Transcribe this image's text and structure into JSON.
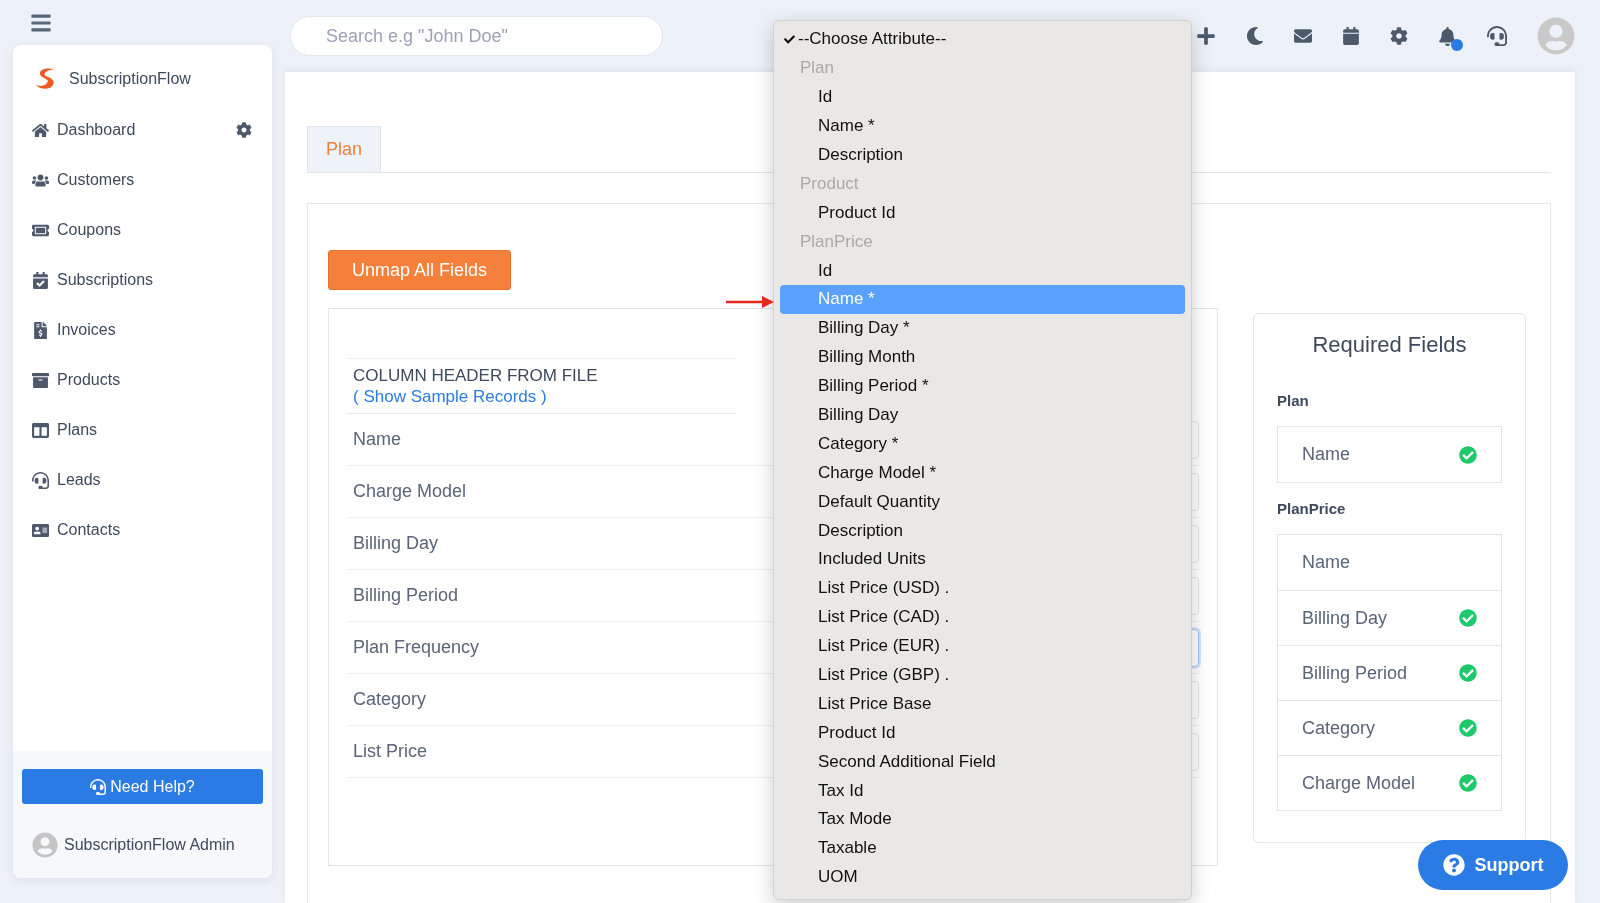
{
  "sidebar": {
    "brand": "SubscriptionFlow",
    "items": [
      {
        "label": "Dashboard"
      },
      {
        "label": "Customers"
      },
      {
        "label": "Coupons"
      },
      {
        "label": "Subscriptions"
      },
      {
        "label": "Invoices"
      },
      {
        "label": "Products"
      },
      {
        "label": "Plans"
      },
      {
        "label": "Leads"
      },
      {
        "label": "Contacts"
      }
    ],
    "help_button": "Need Help?",
    "user": "SubscriptionFlow Admin"
  },
  "topbar": {
    "search": {
      "placeholder": "Search e.g \"John Doe\""
    },
    "notifications_unread": true
  },
  "tabs": [
    {
      "label": "Plan",
      "selected": true
    }
  ],
  "unmap_button": "Unmap All Fields",
  "mapping": {
    "header": "COLUMN HEADER FROM FILE",
    "header_link": "( Show Sample Records )",
    "rows": [
      {
        "label": "Name",
        "focused": false
      },
      {
        "label": "Charge Model",
        "focused": false
      },
      {
        "label": "Billing Day",
        "focused": false
      },
      {
        "label": "Billing Period",
        "focused": false
      },
      {
        "label": "Plan Frequency",
        "focused": true
      },
      {
        "label": "Category",
        "focused": false
      },
      {
        "label": "List Price",
        "focused": false
      }
    ]
  },
  "dropdown": {
    "current": {
      "label": "--Choose Attribute--",
      "checked": true
    },
    "groups": [
      {
        "label": "Plan",
        "options": [
          {
            "label": "Id",
            "selected": false
          },
          {
            "label": "Name *",
            "selected": false
          },
          {
            "label": "Description",
            "selected": false
          }
        ]
      },
      {
        "label": "Product",
        "options": [
          {
            "label": "Product Id",
            "selected": false
          }
        ]
      },
      {
        "label": "PlanPrice",
        "options": [
          {
            "label": "Id",
            "selected": false
          },
          {
            "label": "Name *",
            "selected": true
          },
          {
            "label": "Billing Day *",
            "selected": false
          },
          {
            "label": "Billing Month",
            "selected": false
          },
          {
            "label": "Billing Period *",
            "selected": false
          },
          {
            "label": "Billing Day",
            "selected": false
          },
          {
            "label": "Category *",
            "selected": false
          },
          {
            "label": "Charge Model *",
            "selected": false
          },
          {
            "label": "Default Quantity",
            "selected": false
          },
          {
            "label": "Description",
            "selected": false
          },
          {
            "label": "Included Units",
            "selected": false
          },
          {
            "label": "List Price (USD) .",
            "selected": false
          },
          {
            "label": "List Price (CAD) .",
            "selected": false
          },
          {
            "label": "List Price (EUR) .",
            "selected": false
          },
          {
            "label": "List Price (GBP) .",
            "selected": false
          },
          {
            "label": "List Price Base",
            "selected": false
          },
          {
            "label": "Product Id",
            "selected": false
          },
          {
            "label": "Second Additional Field",
            "selected": false
          },
          {
            "label": "Tax Id",
            "selected": false
          },
          {
            "label": "Tax Mode",
            "selected": false
          },
          {
            "label": "Taxable",
            "selected": false
          },
          {
            "label": "UOM",
            "selected": false
          }
        ]
      }
    ]
  },
  "required_fields": {
    "title": "Required Fields",
    "groups": [
      {
        "label": "Plan",
        "items": [
          {
            "label": "Name",
            "mapped": true
          }
        ]
      },
      {
        "label": "PlanPrice",
        "items": [
          {
            "label": "Name",
            "mapped": false
          },
          {
            "label": "Billing Day",
            "mapped": true
          },
          {
            "label": "Billing Period",
            "mapped": true
          },
          {
            "label": "Category",
            "mapped": true
          },
          {
            "label": "Charge Model",
            "mapped": true
          }
        ]
      }
    ]
  },
  "support_button": "Support"
}
